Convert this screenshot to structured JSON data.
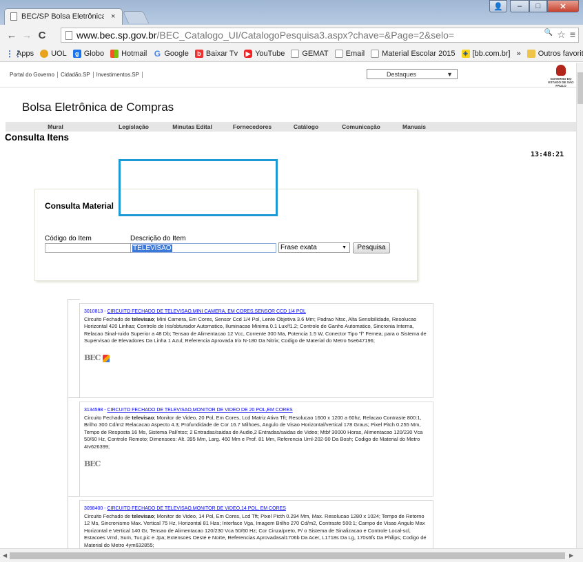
{
  "browser": {
    "tab_title": "BEC/SP Bolsa Eletrônica d",
    "tab_close": "×",
    "url_host": "www.bec.sp.gov.br",
    "url_path": "/BEC_Catalogo_UI/CatalogoPesquisa3.aspx?chave=&Page=2&selo=",
    "back": "←",
    "forward": "→",
    "reload": "C",
    "zoom_icon": "🔍",
    "star": "☆",
    "menu": "≡",
    "window_controls": {
      "user": "👤",
      "minimize": "–",
      "maximize": "□",
      "close": "✕"
    }
  },
  "bookmarks": [
    {
      "label": "Apps",
      "icon": "apps-icon",
      "glyph": "⋮⋮"
    },
    {
      "label": "UOL",
      "icon": "uol-icon",
      "glyph": ""
    },
    {
      "label": "Globo",
      "icon": "globo-icon",
      "glyph": "g"
    },
    {
      "label": "Hotmail",
      "icon": "hotmail-icon",
      "glyph": ""
    },
    {
      "label": "Google",
      "icon": "google-icon",
      "glyph": "G"
    },
    {
      "label": "Baixar Tv",
      "icon": "baixar-icon",
      "glyph": "b"
    },
    {
      "label": "YouTube",
      "icon": "youtube-icon",
      "glyph": "▶"
    },
    {
      "label": "GEMAT",
      "icon": "page-icon",
      "glyph": ""
    },
    {
      "label": "Email",
      "icon": "page-icon",
      "glyph": ""
    },
    {
      "label": "Material Escolar 2015",
      "icon": "page-icon",
      "glyph": ""
    },
    {
      "label": "[bb.com.br]",
      "icon": "bb-icon",
      "glyph": "✳"
    },
    {
      "label": "»",
      "icon": "",
      "glyph": ""
    },
    {
      "label": "Outros favoritos",
      "icon": "folder-icon",
      "glyph": ""
    }
  ],
  "gov": {
    "links": [
      "Portal do Governo",
      "Cidadão.SP",
      "Investimentos.SP"
    ],
    "destaques": "Destaques",
    "seal_text": "GOVERNO DO ESTADO DE SÃO PAULO"
  },
  "site": {
    "name": "Bolsa Eletrônica de Compras",
    "menu": [
      "Mural",
      "Legislação",
      "Minutas Edital",
      "Fornecedores",
      "Catálogo",
      "Comunicação",
      "Manuais"
    ],
    "section_title": "Consulta Itens",
    "clock": "13:48:21"
  },
  "search": {
    "title": "Consulta Material",
    "codigo_label": "Código do Item",
    "codigo_value": "",
    "descricao_label": "Descrição do Item",
    "descricao_value": "TELEVISAO",
    "match_mode": "Frase exata",
    "submit_label": "Pesquisa"
  },
  "results": [
    {
      "code": "3010813",
      "title": "CIRCUITO FECHADO DE TELEVISAO,MINI CAMERA, EM CORES,SENSOR CCD 1/4 POL",
      "desc_before": "Circuito Fechado de ",
      "desc_bold": "televisao",
      "desc_after": "; Mini Camera, Em Cores, Sensor Ccd 1/4 Pol, Lente Objetiva 3.6 Mm; Padrao Ntsc, Alta Sensibilidade, Resolucao Horizontal 420 Linhas; Controle de Iris/obturador Automatico, Iluminacao Minima 0.1 Lux/f1.2; Controle de Ganho Automatico, Sincronia Interna, Relacao Sinal-ruido Superior a 48 Db; Tensao de Alimentacao 12 Vcc, Corrente 300 Ma, Potencia 1.5 W, Conector Tipo \"f\" Femea; para o Sistema de Supervisao de Elevadores Da Linha 1 Azul; Referencia Aprovada Irix N-180 Da Nitrix; Codigo de Material do Metro 5se647196;",
      "logo": "BEC"
    },
    {
      "code": "3134598",
      "title": "CIRCUITO FECHADO DE TELEVISAO,MONITOR DE VIDEO DE 20 POL,EM CORES",
      "desc_before": "Circuito Fechado de ",
      "desc_bold": "televisao",
      "desc_after": "; Monitor de Video, 20 Pol, Em Cores, Lcd Matriz Ativa Tft; Resolucao 1600 x 1200 a 60hz, Relacao Contraste 800:1, Brilho 300 Cd/m2 Relacacao Aspecto 4.3; Profundidade de Cor 16.7 Milhoes, Angulo de Visao Horizontal/vertical 178 Graus; Pixel Pitch 0.255 Mm, Tempo de Resposta 16 Ms, Sistema Pal/ntsc; 2 Entradas/saidas de Audio,2 Entradas/saidas de Video; Mtbf 30000 Horas, Alimentacao 120/230 Vca 50/60 Hz, Controle Remoto; Dimensoes: Alt. 395 Mm, Larg. 460 Mm e Prof. 81 Mm, Referencia Uml-202-90 Da Bosh; Codigo de Material do Metro 4tv626399;",
      "logo": "BEC"
    },
    {
      "code": "3098400",
      "title": "CIRCUITO FECHADO DE TELEVISAO,MONITOR DE VIDEO,14 POL, EM CORES",
      "desc_before": "Circuito Fechado de ",
      "desc_bold": "televisao",
      "desc_after": "; Monitor de Video, 14 Pol, Em Cores, Lcd Tft; Pixel Picth 0.294 Mm, Max. Resolucao 1280 x 1024; Tempo de Retorno 12 Ms, Sincronismo Max. Vertical 75 Hz, Horizontal 81 Hza; Interface Vga, Imagem Brilho 270 Cd/m2, Contraste 500:1; Campo de Visao Angulo Max Horizontal e Vertical 140 Gr, Tensao de Alimentacao 120/230 Vca 50/60 Hz; Cor Cinza/preto, P/ o Sistema de Sinalizacao e Controle Local-scl, Estacoes Vmd, Sum, Tuc,pic e Jpa; Extensoes Oeste e Norte, Referencias Aprovadasal1706b Da Acer, L1718s Da Lg, 170s6fs Da Philips; Codigo de Material do Metro 4ym632855;",
      "logo": ""
    }
  ],
  "colors": {
    "highlight": "#1c9ad6",
    "link": "#0000ee",
    "selection": "#3b78d8"
  }
}
